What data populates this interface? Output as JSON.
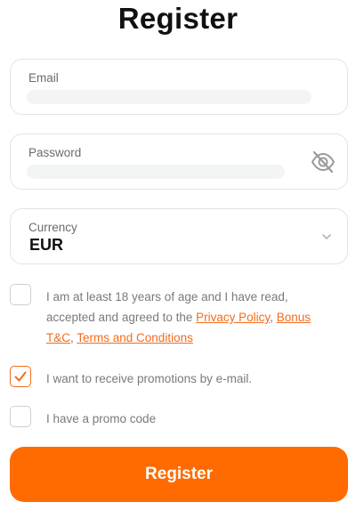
{
  "page": {
    "title": "Register"
  },
  "form": {
    "email": {
      "label": "Email"
    },
    "password": {
      "label": "Password"
    },
    "currency": {
      "label": "Currency",
      "value": "EUR"
    }
  },
  "checks": {
    "age": {
      "checked": false,
      "text_part1": "I am at least 18 years of age and I have read, accepted and agreed to the ",
      "privacy_link": "Privacy Policy",
      "sep1": ", ",
      "bonus_link": "Bonus T&C",
      "sep2": ", ",
      "terms_link": "Terms and Conditions"
    },
    "promotions": {
      "checked": true,
      "text": "I want to receive promotions by e-mail."
    },
    "promo_code": {
      "checked": false,
      "text": "I have a promo code"
    }
  },
  "actions": {
    "register_label": "Register"
  },
  "colors": {
    "accent": "#ff6b00",
    "link": "#f26b1d",
    "border": "#e3e3e3"
  },
  "icons": {
    "password_toggle": "eye-off-icon",
    "currency_dropdown": "chevron-down-icon",
    "check": "check-icon"
  }
}
